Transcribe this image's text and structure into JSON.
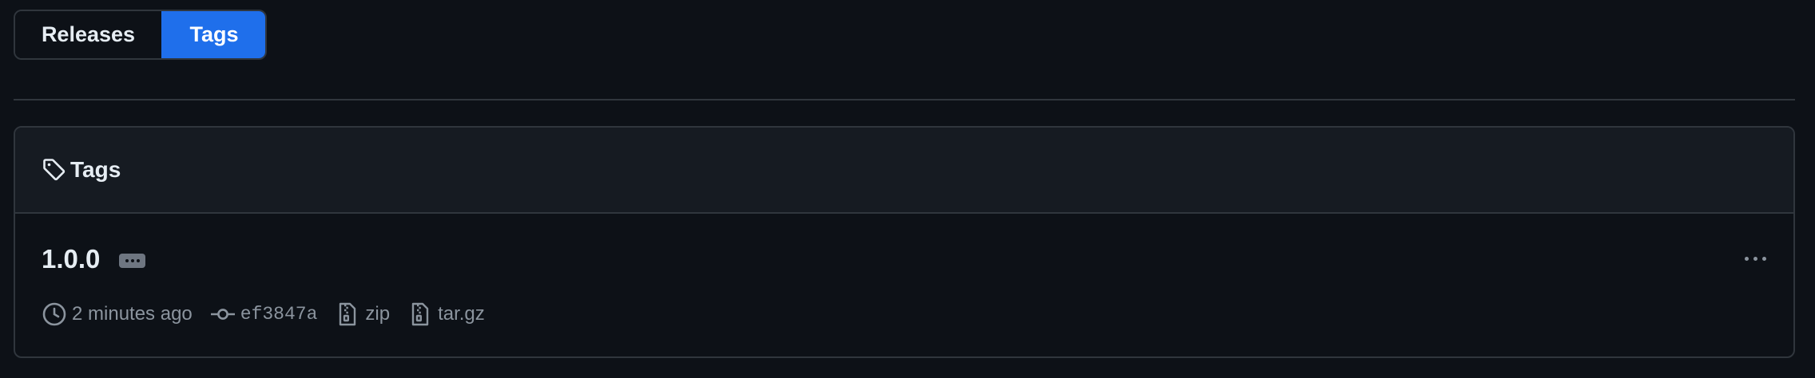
{
  "tabs": [
    {
      "label": "Releases",
      "active": false
    },
    {
      "label": "Tags",
      "active": true
    }
  ],
  "colors": {
    "background": "#0d1117",
    "accent": "#1f6feb",
    "border": "#30363d",
    "header_bg": "#161b22",
    "muted_text": "#8b949e"
  },
  "tags_box": {
    "title": "Tags",
    "icon": "tag-icon",
    "items": [
      {
        "name": "1.0.0",
        "time": "2 minutes ago",
        "commit": "ef3847a",
        "zip_label": "zip",
        "targz_label": "tar.gz"
      }
    ]
  }
}
